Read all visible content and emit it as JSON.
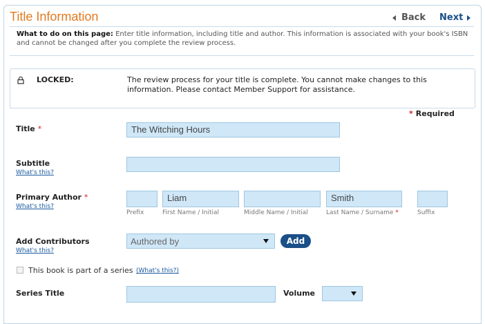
{
  "header": {
    "title": "Title Information",
    "back_label": "Back",
    "next_label": "Next"
  },
  "instructions": {
    "label": "What to do on this page:",
    "text": "Enter title information, including title and author. This information is associated with your book's ISBN and cannot be changed after you complete the review process."
  },
  "locked": {
    "label": "LOCKED:",
    "message": "The review process for your title is complete. You cannot make changes to this information. Please contact Member Support for assistance."
  },
  "required_note": {
    "star": "*",
    "text": "Required"
  },
  "form": {
    "title": {
      "label": "Title",
      "star": "*",
      "value": "The Witching Hours"
    },
    "subtitle": {
      "label": "Subtitle",
      "help": "What's this?",
      "value": ""
    },
    "primary_author": {
      "label": "Primary Author",
      "star": "*",
      "help": "What's this?",
      "prefix": {
        "value": "",
        "label": "Prefix"
      },
      "first": {
        "value": "Liam",
        "label": "First Name / Initial"
      },
      "middle": {
        "value": "",
        "label": "Middle Name / Initial"
      },
      "last": {
        "value": "Smith",
        "label": "Last Name / Surname",
        "star": "*"
      },
      "suffix": {
        "value": "",
        "label": "Suffix"
      }
    },
    "contributors": {
      "label": "Add Contributors",
      "help": "What's this?",
      "selected": "Authored by",
      "add_label": "Add"
    },
    "series": {
      "checkbox_label": "This book is part of a series",
      "checked": false,
      "help": "(What's this?)"
    },
    "series_title": {
      "label": "Series Title",
      "value": ""
    },
    "volume": {
      "label": "Volume",
      "selected": ""
    }
  },
  "colors": {
    "title": "#e07a1f",
    "link": "#1a5aa0",
    "button": "#1a4f87",
    "input_bg": "#cfe7f7",
    "required_star": "#d32020"
  }
}
